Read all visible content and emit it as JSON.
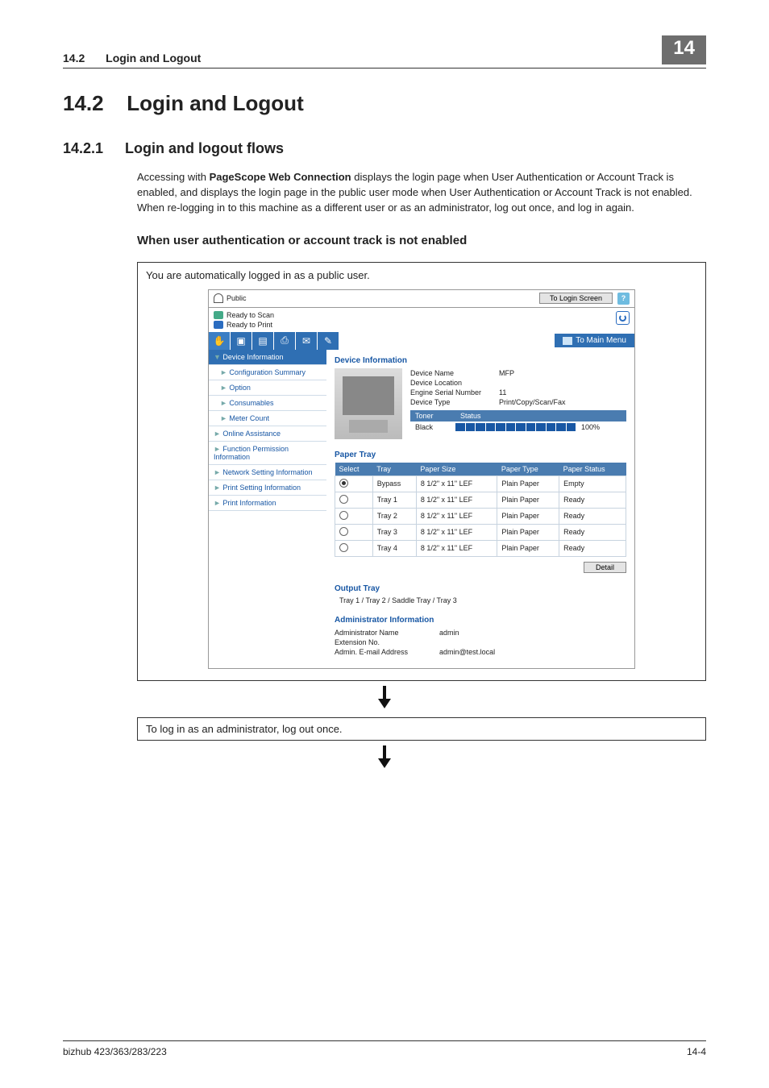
{
  "header": {
    "section_num": "14.2",
    "section_title": "Login and Logout",
    "chapter": "14"
  },
  "h1": {
    "num": "14.2",
    "title": "Login and Logout"
  },
  "h2": {
    "num": "14.2.1",
    "title": "Login and logout flows"
  },
  "intro": {
    "pre": "Accessing with ",
    "bold": "PageScope Web Connection",
    "post": " displays the login page when User Authentication or Account Track is enabled, and displays the login page in the public user mode when User Authentication or Account Track is not enabled. When re-logging in to this machine as a different user or as an administrator, log out once, and log in again."
  },
  "h3": "When user authentication or account track is not enabled",
  "flow1": "You are automatically logged in as a public user.",
  "flow2": "To log in as an administrator, log out once.",
  "footer": {
    "left": "bizhub 423/363/283/223",
    "right": "14-4"
  },
  "shot": {
    "top": {
      "user": "Public",
      "login_btn": "To Login Screen"
    },
    "status": {
      "scan": "Ready to Scan",
      "print": "Ready to Print"
    },
    "to_main": "To Main Menu",
    "side": [
      {
        "label": "Device Information",
        "active": true,
        "marker": "▼"
      },
      {
        "label": "Configuration Summary",
        "sub": true,
        "marker": "►"
      },
      {
        "label": "Option",
        "sub": true,
        "marker": "►"
      },
      {
        "label": "Consumables",
        "sub": true,
        "marker": "►"
      },
      {
        "label": "Meter Count",
        "sub": true,
        "marker": "►"
      },
      {
        "label": "Online Assistance",
        "marker": "►"
      },
      {
        "label": "Function Permission Information",
        "marker": "►"
      },
      {
        "label": "Network Setting Information",
        "marker": "►"
      },
      {
        "label": "Print Setting Information",
        "marker": "►"
      },
      {
        "label": "Print Information",
        "marker": "►"
      }
    ],
    "dev": {
      "heading": "Device Information",
      "rows": [
        {
          "k": "Device Name",
          "v": "MFP"
        },
        {
          "k": "Device Location",
          "v": ""
        },
        {
          "k": "Engine Serial Number",
          "v": "11"
        },
        {
          "k": "Device Type",
          "v": "Print/Copy/Scan/Fax"
        }
      ],
      "toner_h1": "Toner",
      "toner_h2": "Status",
      "toner_name": "Black",
      "toner_pct": "100%"
    },
    "paper": {
      "heading": "Paper Tray",
      "cols": [
        "Select",
        "Tray",
        "Paper Size",
        "Paper Type",
        "Paper Status"
      ],
      "rows": [
        {
          "sel": true,
          "tray": "Bypass",
          "size": "8 1/2\" x 11\" LEF",
          "type": "Plain Paper",
          "status": "Empty"
        },
        {
          "sel": false,
          "tray": "Tray 1",
          "size": "8 1/2\" x 11\" LEF",
          "type": "Plain Paper",
          "status": "Ready"
        },
        {
          "sel": false,
          "tray": "Tray 2",
          "size": "8 1/2\" x 11\" LEF",
          "type": "Plain Paper",
          "status": "Ready"
        },
        {
          "sel": false,
          "tray": "Tray 3",
          "size": "8 1/2\" x 11\" LEF",
          "type": "Plain Paper",
          "status": "Ready"
        },
        {
          "sel": false,
          "tray": "Tray 4",
          "size": "8 1/2\" x 11\" LEF",
          "type": "Plain Paper",
          "status": "Ready"
        }
      ],
      "detail": "Detail"
    },
    "output": {
      "heading": "Output Tray",
      "line": "Tray 1 / Tray 2 / Saddle Tray / Tray 3"
    },
    "admin": {
      "heading": "Administrator Information",
      "rows": [
        {
          "k": "Administrator Name",
          "v": "admin"
        },
        {
          "k": "Extension No.",
          "v": ""
        },
        {
          "k": "Admin. E-mail Address",
          "v": "admin@test.local"
        }
      ]
    }
  }
}
